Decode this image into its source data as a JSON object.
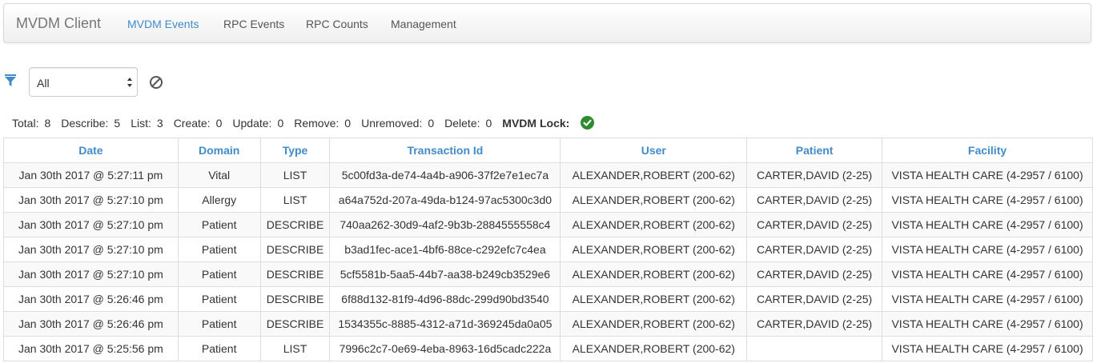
{
  "navbar": {
    "brand": "MVDM Client",
    "links": [
      {
        "label": "MVDM Events",
        "active": true
      },
      {
        "label": "RPC Events",
        "active": false
      },
      {
        "label": "RPC Counts",
        "active": false
      },
      {
        "label": "Management",
        "active": false
      }
    ]
  },
  "filter": {
    "icon": "filter-icon",
    "selected": "All",
    "clear_icon": "ban-icon"
  },
  "stats": {
    "total_label": "Total:",
    "total": "8",
    "describe_label": "Describe:",
    "describe": "5",
    "list_label": "List:",
    "list": "3",
    "create_label": "Create:",
    "create": "0",
    "update_label": "Update:",
    "update": "0",
    "remove_label": "Remove:",
    "remove": "0",
    "unremoved_label": "Unremoved:",
    "unremoved": "0",
    "delete_label": "Delete:",
    "delete": "0",
    "lock_label": "MVDM Lock:",
    "lock_icon": "check-circle-icon",
    "lock_color": "#2e8b2e"
  },
  "table": {
    "columns": [
      "Date",
      "Domain",
      "Type",
      "Transaction Id",
      "User",
      "Patient",
      "Facility"
    ],
    "rows": [
      [
        "Jan 30th 2017 @ 5:27:11 pm",
        "Vital",
        "LIST",
        "5c00fd3a-de74-4a4b-a906-37f2e7e1ec7a",
        "ALEXANDER,ROBERT (200-62)",
        "CARTER,DAVID (2-25)",
        "VISTA HEALTH CARE (4-2957 / 6100)"
      ],
      [
        "Jan 30th 2017 @ 5:27:10 pm",
        "Allergy",
        "LIST",
        "a64a752d-207a-49da-b124-97ac5300c3d0",
        "ALEXANDER,ROBERT (200-62)",
        "CARTER,DAVID (2-25)",
        "VISTA HEALTH CARE (4-2957 / 6100)"
      ],
      [
        "Jan 30th 2017 @ 5:27:10 pm",
        "Patient",
        "DESCRIBE",
        "740aa262-30d9-4af2-9b3b-2884555558c4",
        "ALEXANDER,ROBERT (200-62)",
        "CARTER,DAVID (2-25)",
        "VISTA HEALTH CARE (4-2957 / 6100)"
      ],
      [
        "Jan 30th 2017 @ 5:27:10 pm",
        "Patient",
        "DESCRIBE",
        "b3ad1fec-ace1-4bf6-88ce-c292efc7c4ea",
        "ALEXANDER,ROBERT (200-62)",
        "CARTER,DAVID (2-25)",
        "VISTA HEALTH CARE (4-2957 / 6100)"
      ],
      [
        "Jan 30th 2017 @ 5:27:10 pm",
        "Patient",
        "DESCRIBE",
        "5cf5581b-5aa5-44b7-aa38-b249cb3529e6",
        "ALEXANDER,ROBERT (200-62)",
        "CARTER,DAVID (2-25)",
        "VISTA HEALTH CARE (4-2957 / 6100)"
      ],
      [
        "Jan 30th 2017 @ 5:26:46 pm",
        "Patient",
        "DESCRIBE",
        "6f88d132-81f9-4d96-88dc-299d90bd3540",
        "ALEXANDER,ROBERT (200-62)",
        "CARTER,DAVID (2-25)",
        "VISTA HEALTH CARE (4-2957 / 6100)"
      ],
      [
        "Jan 30th 2017 @ 5:26:46 pm",
        "Patient",
        "DESCRIBE",
        "1534355c-8885-4312-a71d-369245da0a05",
        "ALEXANDER,ROBERT (200-62)",
        "CARTER,DAVID (2-25)",
        "VISTA HEALTH CARE (4-2957 / 6100)"
      ],
      [
        "Jan 30th 2017 @ 5:25:56 pm",
        "Patient",
        "LIST",
        "7996c2c7-0e69-4eba-8963-16d5cadc222a",
        "ALEXANDER,ROBERT (200-62)",
        "",
        "VISTA HEALTH CARE (4-2957 / 6100)"
      ]
    ]
  },
  "colors": {
    "accent": "#428bca",
    "text": "#333333",
    "border": "#dddddd",
    "stripe": "#f9f9f9"
  }
}
